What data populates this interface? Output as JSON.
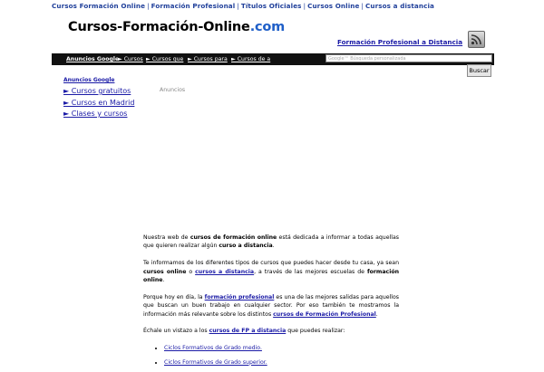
{
  "topnav": {
    "items": [
      "Cursos Formación Online",
      "Formación Profesional",
      "Títulos Oficiales",
      "Cursos Online",
      "Cursos a distancia"
    ],
    "separator": "|"
  },
  "logo": {
    "main": "Cursos-Formación-Online",
    "suffix": ".com"
  },
  "header_link": "Formación Profesional a Distancia",
  "rss_icon": "rss-feed-icon",
  "blackbar": {
    "ads_label": "Anuncios Google",
    "links": [
      "► Cursos",
      "► Cursos que",
      "► Cursos para",
      "► Cursos de a"
    ]
  },
  "search": {
    "placeholder": "Google™ Búsqueda personalizada",
    "button": "Buscar"
  },
  "sidebar_ads": {
    "heading": "Anuncios Google",
    "items": [
      "► Cursos gratuitos",
      "► Cursos en Madrid",
      "► Clases y cursos"
    ]
  },
  "anuncios_label": "Anuncios",
  "content": {
    "p1": {
      "t1": "Nuestra web de ",
      "b1": "cursos de formación online",
      "t2": " está dedicada a informar a todas aquellas que quieren realizar algún ",
      "b2": "curso a distancia",
      "t3": "."
    },
    "p2": {
      "t1": "Te informamos de los diferentes tipos de cursos que puedes hacer desde tu casa, ya sean ",
      "b1": "cursos online",
      "t2": " o ",
      "link1": "cursos a distancia",
      "t3": ", a través de las mejores escuelas de ",
      "b2": "formación online",
      "t4": "."
    },
    "p3": {
      "t1": "Porque hoy en día, la ",
      "link1": "formación profesional",
      "t2": " es una de las mejores salidas para aquellos que buscan un buen trabajo en cualquier sector. Por eso también te mostramos la información más relevante sobre los distintos ",
      "link2": "cursos de Formación Profesional",
      "t3": "."
    },
    "p4": {
      "t1": "Échale un vistazo a los ",
      "link1": "cursos de FP a distancia",
      "t2": " que puedes realizar:"
    },
    "list": [
      "Ciclos Formativos de Grado medio.",
      "Ciclos Formativos de Grado superior."
    ]
  }
}
